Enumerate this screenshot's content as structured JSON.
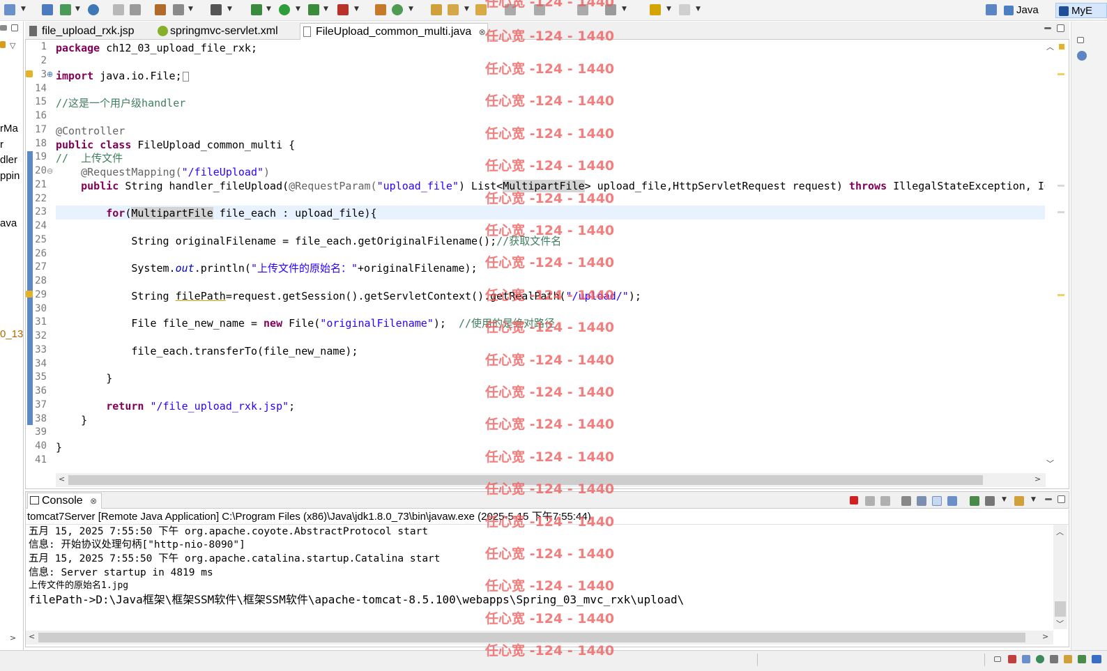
{
  "toolbar": {
    "perspectives": {
      "java_label": "Java",
      "myb_label": "MyE"
    }
  },
  "left_strip": {
    "fragments": [
      "rMa",
      "r",
      "dler",
      "ppin",
      "ava",
      "0_13"
    ]
  },
  "editor": {
    "tabs": [
      {
        "label": "file_upload_rxk.jsp"
      },
      {
        "label": "springmvc-servlet.xml"
      },
      {
        "label": "FileUpload_common_multi.java",
        "active": true
      }
    ],
    "line_numbers": [
      "1",
      "2",
      "3",
      "14",
      "15",
      "16",
      "17",
      "18",
      "19",
      "20",
      "21",
      "22",
      "23",
      "24",
      "25",
      "26",
      "27",
      "28",
      "29",
      "30",
      "31",
      "32",
      "33",
      "34",
      "35",
      "36",
      "37",
      "38",
      "39",
      "40",
      "41"
    ],
    "code": {
      "l1_kw": "package",
      "l1_rest": " ch12_03_upload_file_rxk;",
      "l3_kw": "import",
      "l3_rest": " java.io.File;",
      "l15": "//这是一个用户级handler",
      "l17": "@Controller",
      "l18_kw1": "public",
      "l18_kw2": "class",
      "l18_rest": " FileUpload_common_multi {",
      "l19": "//  上传文件",
      "l20_ann": "    @RequestMapping(",
      "l20_str": "\"/fileUpload\"",
      "l20_end": ")",
      "l21_kw": "    public",
      "l21_a": " String handler_fileUpload(",
      "l21_ann": "@RequestParam(",
      "l21_str": "\"upload_file\"",
      "l21_b": ") List<",
      "l21_hl": "MultipartFile",
      "l21_c": "> upload_file,HttpServletRequest request) ",
      "l21_kw2": "throws",
      "l21_d": " IllegalStateException, IOEx",
      "l23_kw": "        for",
      "l23_a": "(",
      "l23_hl": "MultipartFile",
      "l23_b": " file_each : upload_file){",
      "l25_a": "            String originalFilename = file_each.getOriginalFilename();",
      "l25_cmt": "//获取文件名",
      "l27_a": "            System.",
      "l27_fld": "out",
      "l27_b": ".println(",
      "l27_str": "\"上传文件的原始名：\"",
      "l27_c": "+originalFilename);",
      "l29_a": "            String ",
      "l29_ul": "filePath",
      "l29_b": "=request.getSession().getServletContext().getRealPath(",
      "l29_str": "\"/upload/\"",
      "l29_c": ");",
      "l31_a": "            File file_new_name = ",
      "l31_kw": "new",
      "l31_b": " File(",
      "l31_str": "\"originalFilename\"",
      "l31_c": ");  ",
      "l31_cmt": "//使用的是绝对路径",
      "l33": "            file_each.transferTo(file_new_name);",
      "l35": "        }",
      "l37_kw": "        return",
      "l37_sp": " ",
      "l37_str": "\"/file_upload_rxk.jsp\"",
      "l37_end": ";",
      "l38": "    }",
      "l40": "}"
    }
  },
  "console": {
    "tab_label": "Console",
    "description": "tomcat7Server [Remote Java Application] C:\\Program Files (x86)\\Java\\jdk1.8.0_73\\bin\\javaw.exe (2025-5-15 下午7:55:44)",
    "lines": [
      "五月 15, 2025 7:55:50 下午 org.apache.coyote.AbstractProtocol start",
      "信息: 开始协议处理句柄[\"http-nio-8090\"]",
      "五月 15, 2025 7:55:50 下午 org.apache.catalina.startup.Catalina start",
      "信息: Server startup in 4819 ms",
      "上传文件的原始名1.jpg",
      "filePath->D:\\Java框架\\框架SSM软件\\框架SSM软件\\apache-tomcat-8.5.100\\webapps\\Spring_03_mvc_rxk\\upload\\"
    ]
  },
  "watermark": {
    "text": "任心宽 -124 - 1440"
  },
  "colors": {
    "keyword": "#7f0055",
    "string": "#2a00ff",
    "comment": "#3f7f5f",
    "watermark": "#f05a5a",
    "range_bar": "#5b89c8"
  }
}
